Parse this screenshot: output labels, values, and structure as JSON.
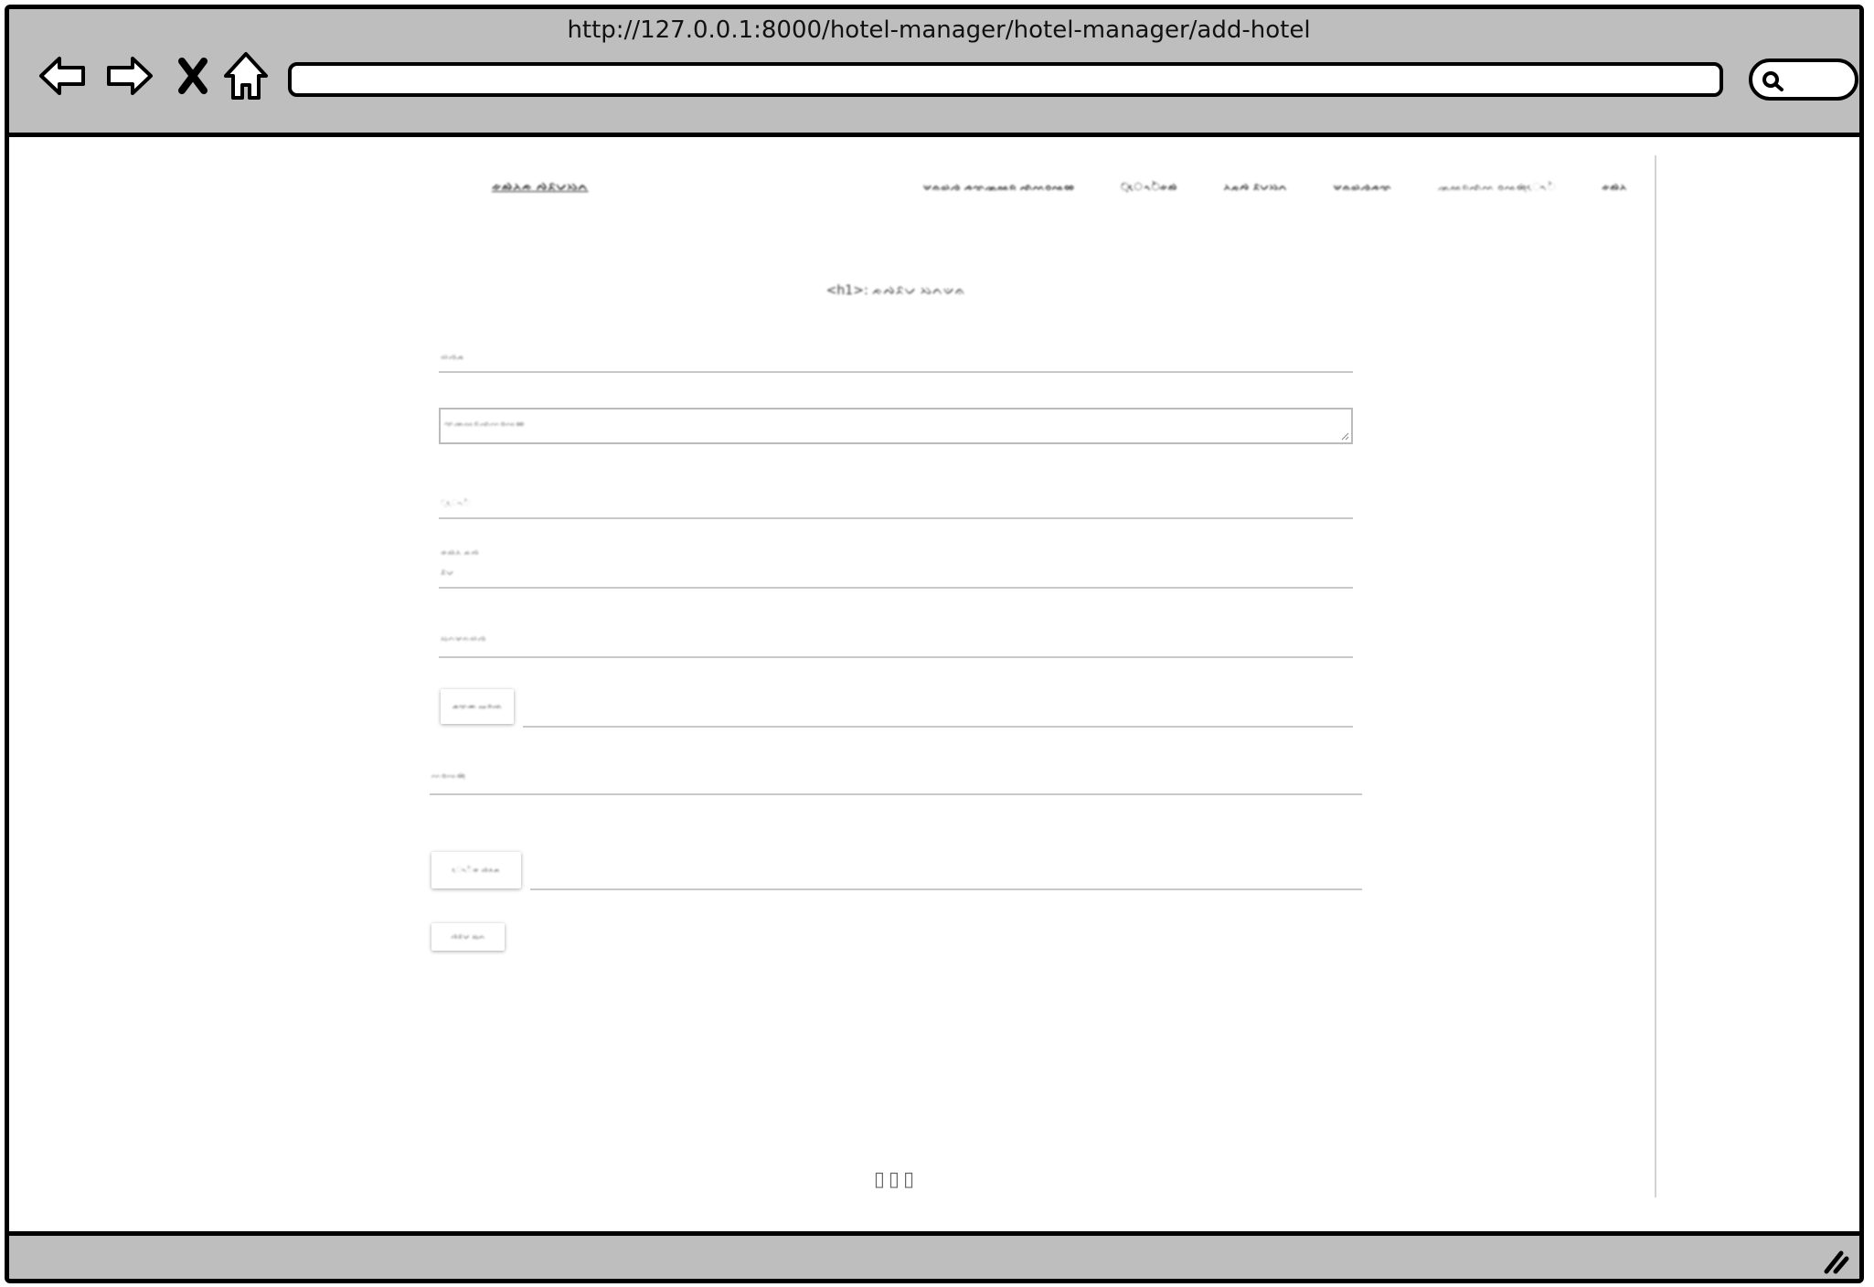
{
  "browser": {
    "url": "http://127.0.0.1:8000/hotel-manager/hotel-manager/add-hotel"
  },
  "page": {
    "brand": "ᨀᨁᨂᨃ ᨄᨅᨆᨇᨈ",
    "nav": [
      "ᨉᨊᨋᨌ ᨍᨎᨏᨐᨑ ᨒᨓᨔᨕᨖ",
      "ᨘᨗᨙ ᨚᨛᨀᨁ",
      "ᨂᨃᨄ ᨅᨆᨇᨈ",
      "ᨉᨊᨋᨌᨍᨎ",
      "ᨏᨐᨑᨒᨓ ᨔᨕᨖᨘᨗᨙᨚᨛ",
      "ᨀᨁᨂ"
    ],
    "title": "<h1>: ᨃᨄᨅᨆ ᨇᨈᨉᨊ",
    "form": {
      "field_name": "ᨋᨌᨍ",
      "textarea_placeholder": "ᨎᨏᨐᨑᨒᨓᨔᨕᨖ",
      "field_3": "ᨘᨗᨙᨚᨛ",
      "field_4_label": "ᨀᨁᨂ ᨃᨄ",
      "field_4_value": "ᨅᨆ",
      "field_5": "ᨇᨈᨉᨊᨋᨌ",
      "upload_button_1": "ᨍᨎᨏ ᨐᨑᨒ",
      "field_6": "ᨓᨔᨕᨖᨘᨗ",
      "upload_button_2": "ᨙᨚᨛᨀ ᨁᨂᨃ",
      "submit_button": "ᨄᨅᨆ ᨇᨈ"
    },
    "pagination": "▯▯▯"
  }
}
